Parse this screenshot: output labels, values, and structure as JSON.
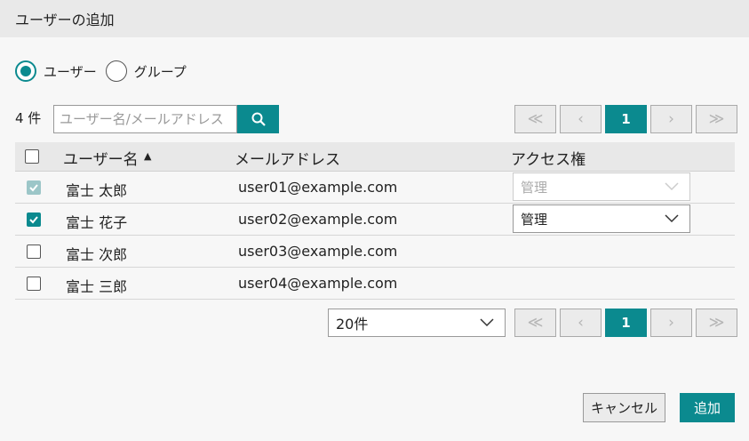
{
  "dialog": {
    "title": "ユーザーの追加"
  },
  "target_type": {
    "options": [
      {
        "label": "ユーザー",
        "selected": true
      },
      {
        "label": "グループ",
        "selected": false
      }
    ]
  },
  "search": {
    "count_label": "4 件",
    "placeholder": "ユーザー名/メールアドレス",
    "icon": "search-icon"
  },
  "pagination": {
    "first": "≪",
    "prev": "‹",
    "current": "1",
    "next": "›",
    "last": "≫"
  },
  "table": {
    "columns": {
      "name": "ユーザー名",
      "sort_indicator": "▲",
      "email": "メールアドレス",
      "access": "アクセス権"
    },
    "rows": [
      {
        "name": "富士 太郎",
        "email": "user01@example.com",
        "checked": true,
        "disabled": true,
        "access": "管理"
      },
      {
        "name": "富士 花子",
        "email": "user02@example.com",
        "checked": true,
        "disabled": false,
        "access": "管理"
      },
      {
        "name": "富士 次郎",
        "email": "user03@example.com",
        "checked": false,
        "disabled": false,
        "access": ""
      },
      {
        "name": "富士 三郎",
        "email": "user04@example.com",
        "checked": false,
        "disabled": false,
        "access": ""
      }
    ]
  },
  "page_size": {
    "value": "20件"
  },
  "footer": {
    "cancel_label": "キャンセル",
    "ok_label": "追加"
  },
  "colors": {
    "accent": "#0b8a8f"
  }
}
